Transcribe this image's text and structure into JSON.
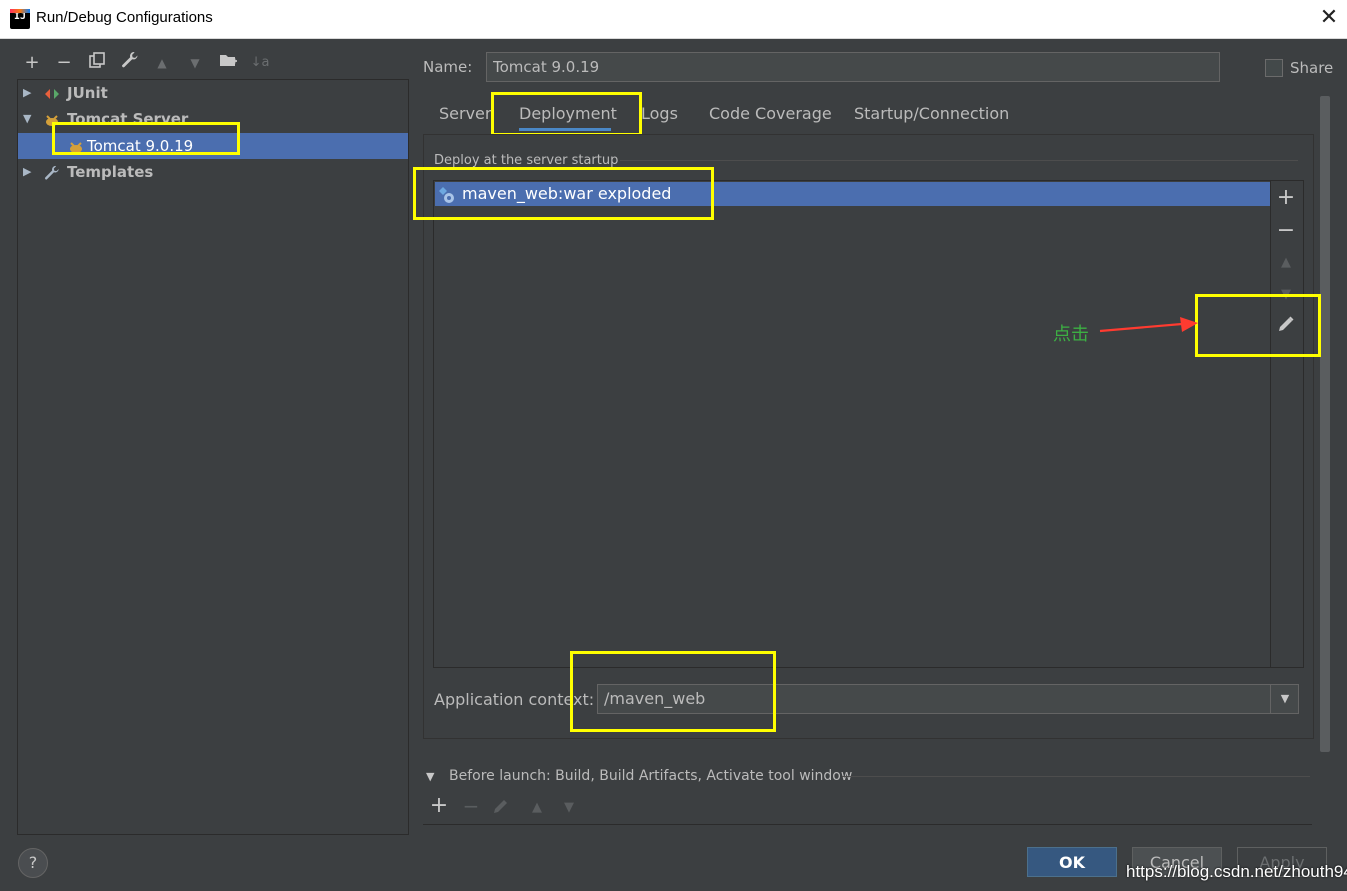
{
  "window": {
    "title": "Run/Debug Configurations",
    "close_glyph": "✕"
  },
  "toolbar": {
    "add": "+",
    "remove": "−",
    "copy": "❐",
    "edit_defaults": "🔧",
    "move_up": "▲",
    "move_down": "▼",
    "new_folder": "📁",
    "sort": "↓a"
  },
  "tree": {
    "junit": "JUnit",
    "tomcat_server": "Tomcat Server",
    "tomcat_config": "Tomcat 9.0.19",
    "templates": "Templates"
  },
  "config": {
    "name_label": "Name:",
    "name_value": "Tomcat 9.0.19",
    "share_label": "Share"
  },
  "tabs": [
    {
      "label": "Server"
    },
    {
      "label": "Deployment"
    },
    {
      "label": "Logs"
    },
    {
      "label": "Code Coverage"
    },
    {
      "label": "Startup/Connection"
    }
  ],
  "deployment": {
    "section_title": "Deploy at the server startup",
    "items": [
      "maven_web:war exploded"
    ],
    "context_label": "Application context:",
    "context_value": "/maven_web"
  },
  "annotation": {
    "text": "点击"
  },
  "before_launch": {
    "label": "Before launch: Build, Build Artifacts, Activate tool window"
  },
  "buttons": {
    "ok": "OK",
    "cancel": "Cancel",
    "apply": "Apply",
    "help": "?"
  },
  "watermark": "https://blog.csdn.net/zhouth94",
  "colors": {
    "background": "#3c3f41",
    "selection": "#4b6eaf",
    "highlight_box": "#ffff00",
    "annotation_arrow": "#ff3b30",
    "annotation_text": "#3cb043"
  }
}
